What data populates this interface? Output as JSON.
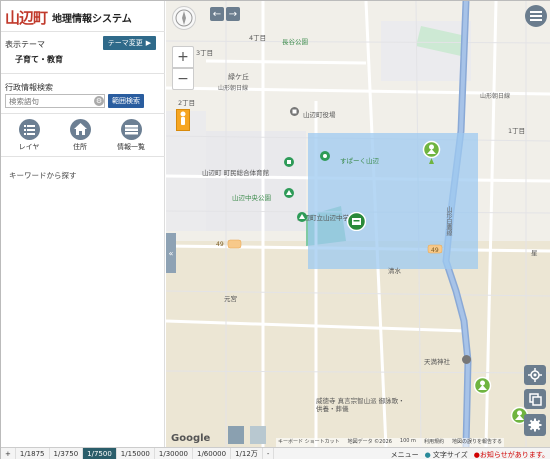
{
  "header": {
    "town": "山辺町",
    "system_title": "地理情報システム"
  },
  "sidebar": {
    "theme_label": "表示テーマ",
    "theme_button": "テーマ変更",
    "theme_value": "子育て・教育",
    "admin_search_label": "行政情報検索",
    "search_placeholder": "検索語句",
    "range_search_button": "範囲検索",
    "tools": [
      {
        "label": "レイヤ",
        "icon": "list-icon"
      },
      {
        "label": "住所",
        "icon": "house-icon"
      },
      {
        "label": "情報一覧",
        "icon": "table-icon"
      }
    ],
    "keyword_hint": "キーワードから探す"
  },
  "map": {
    "labels": {
      "chome4": "4丁目",
      "chome3": "3丁目",
      "chome2": "2丁目",
      "chome1": "1丁目",
      "nagasaki_park": "長谷公園",
      "midorigaoka": "緑ケ丘",
      "yamagata_asahi_w": "山形朝日線",
      "yamagata_asahi_e": "山形朝日線",
      "town_office": "山辺町役場",
      "hall": "山辺町 町民総合体育館",
      "central_park": "山辺中央公園",
      "yamanobe_jhs": "山辺町立山辺中学",
      "suparku": "すぱーく山辺",
      "road_49": "49",
      "road_49b": "49",
      "road_17": "17",
      "hoshi": "星",
      "shimizu": "清水",
      "motomiya": "元宮",
      "tenman": "天満神社",
      "temple": "威徳寺 真言宗智山派 御詠歌・供養・葬儀",
      "prefroad": "山形白鷹線"
    },
    "attribution": [
      "キーボード ショートカット",
      "地図データ ©2026",
      "100 m",
      "利用規約",
      "地図の誤りを報告する"
    ],
    "google": "Google"
  },
  "footer": {
    "plus": "+",
    "minus": "-",
    "scales": [
      "1/1875",
      "1/3750",
      "1/7500",
      "1/15000",
      "1/30000",
      "1/60000",
      "1/12万"
    ],
    "active_scale": "1/7500",
    "menu": "メニュー",
    "font_size": "文字サイズ",
    "notice": "お知らせがあります。"
  }
}
